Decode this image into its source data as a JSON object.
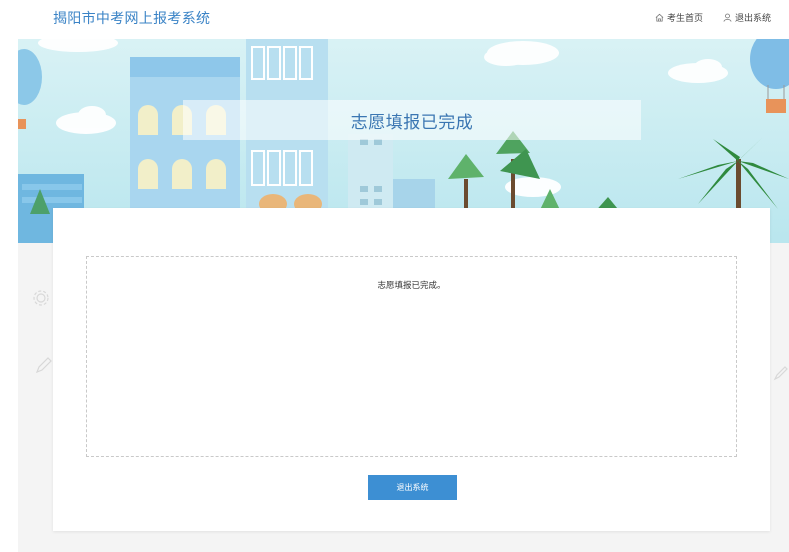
{
  "header": {
    "site_title": "揭阳市中考网上报考系统",
    "nav": [
      {
        "label": "考生首页",
        "icon": "home-icon"
      },
      {
        "label": "退出系统",
        "icon": "user-icon"
      }
    ]
  },
  "banner": {
    "title": "志愿填报已完成"
  },
  "content": {
    "message": "志愿填报已完成。",
    "exit_button": "退出系统"
  },
  "colors": {
    "brand_blue": "#3a83c6",
    "button_blue": "#3d8fd3",
    "banner_sky": "#c6ebf2"
  }
}
